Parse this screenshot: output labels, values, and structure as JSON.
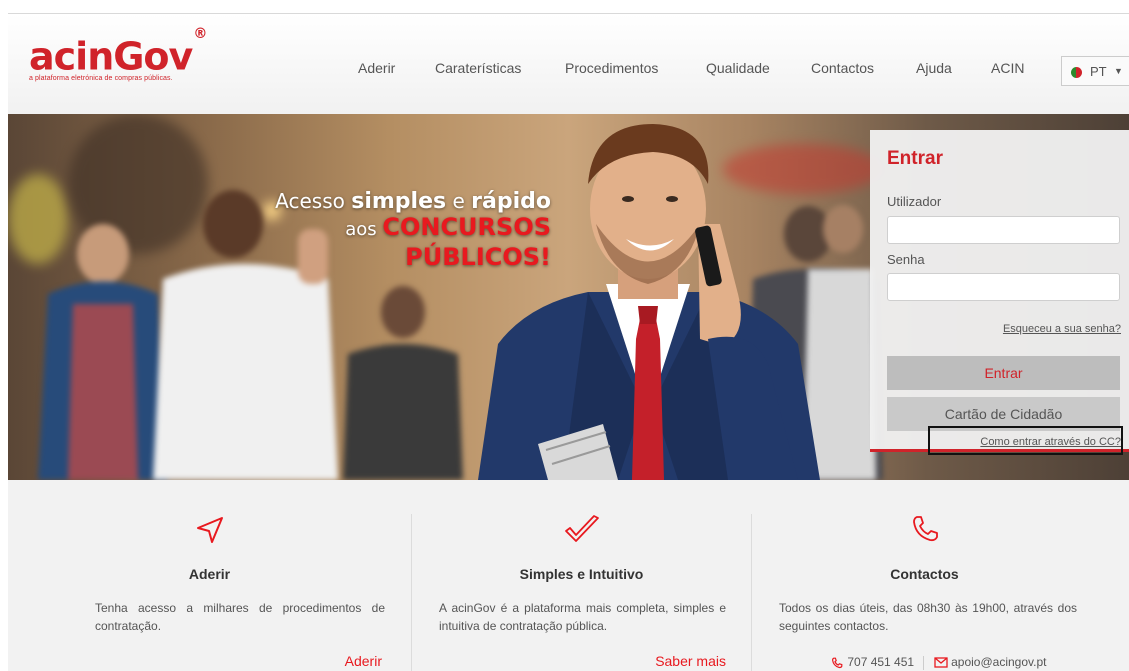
{
  "brand": {
    "name": "acinGov",
    "registered": "®",
    "tagline": "a plataforma eletrónica de compras públicas."
  },
  "nav": {
    "items": [
      "Aderir",
      "Caraterísticas",
      "Procedimentos",
      "Qualidade",
      "Contactos",
      "Ajuda",
      "ACIN"
    ],
    "language": "PT"
  },
  "hero": {
    "line1_a": "Acesso ",
    "line1_b": "simples",
    "line1_c": " e ",
    "line1_d": "rápido",
    "line2_a": "aos ",
    "line2_b": "CONCURSOS",
    "line3": "PÚBLICOS!"
  },
  "login": {
    "title": "Entrar",
    "user_label": "Utilizador",
    "user_value": "",
    "password_label": "Senha",
    "password_value": "",
    "forgot_link": "Esqueceu a sua senha?",
    "submit_label": "Entrar",
    "cc_button_label": "Cartão de Cidadão",
    "cc_help_link": "Como entrar através do CC?"
  },
  "features": {
    "aderir": {
      "icon": "paper-plane-icon",
      "title": "Aderir",
      "desc": "Tenha acesso a milhares de procedimentos de contratação.",
      "link": "Aderir"
    },
    "simples": {
      "icon": "checkmark-icon",
      "title": "Simples e Intuitivo",
      "desc": "A acinGov é a plataforma mais completa, simples e intuitiva de contratação pública.",
      "link": "Saber mais"
    },
    "contactos": {
      "icon": "phone-icon",
      "title": "Contactos",
      "desc": "Todos os dias úteis, das 08h30 às 19h00, através dos seguintes contactos.",
      "phone": "707 451 451",
      "email": "apoio@acingov.pt"
    }
  },
  "colors": {
    "brand_red": "#d0232a",
    "accent_red": "#e8191f"
  }
}
